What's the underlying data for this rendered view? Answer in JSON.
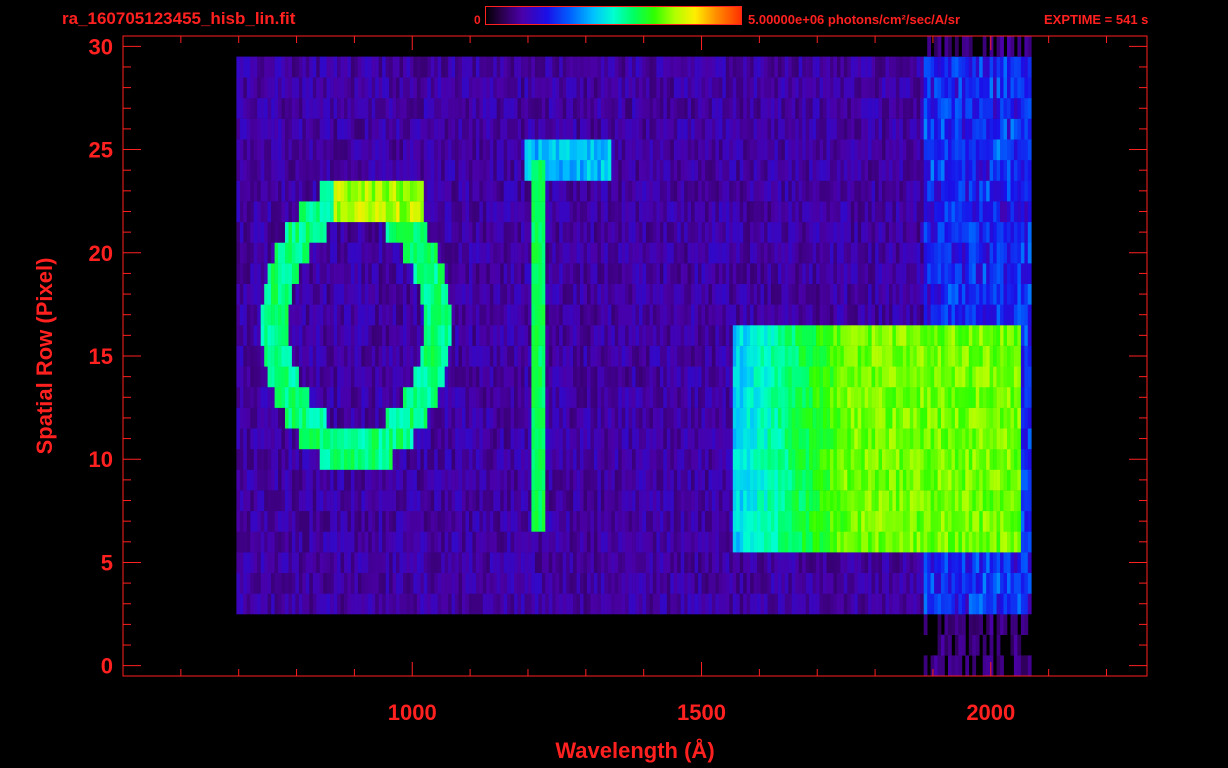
{
  "header": {
    "file_title": "ra_160705123455_hisb_lin.fit",
    "colorbar_min": "0",
    "colorbar_max_text": "5.00000e+06 photons/cm²/sec/A/sr",
    "exptime_text": "EXPTIME = 541 s"
  },
  "colors": {
    "axis": "#ff2020",
    "background": "#000000",
    "colormap": [
      "#000000",
      "#2a004a",
      "#4a00a8",
      "#1a10e8",
      "#0060ff",
      "#00c0ff",
      "#00ffd0",
      "#00ff60",
      "#30ff00",
      "#b0ff00",
      "#ffee00",
      "#ff9000",
      "#ff3000"
    ]
  },
  "chart_data": {
    "type": "heatmap",
    "title": "ra_160705123455_hisb_lin.fit",
    "xlabel": "Wavelength (Å)",
    "ylabel": "Spatial Row (Pixel)",
    "xlim": [
      500,
      2270
    ],
    "ylim": [
      -0.5,
      30.5
    ],
    "xticks": [
      1000,
      1500,
      2000
    ],
    "yticks": [
      0,
      5,
      10,
      15,
      20,
      25,
      30
    ],
    "colorbar": {
      "min": 0,
      "max": 5000000,
      "units": "photons/cm²/sec/A/sr"
    },
    "exptime_s": 541,
    "features": [
      {
        "name": "ring",
        "cx": 900,
        "cy": 16.5,
        "rx": 140,
        "ry": 6
      },
      {
        "name": "emission_line",
        "x": 1216,
        "y_range": [
          7,
          24
        ]
      },
      {
        "name": "continuum_band",
        "x_range": [
          1650,
          2050
        ],
        "y_range": [
          6,
          16
        ]
      }
    ]
  }
}
